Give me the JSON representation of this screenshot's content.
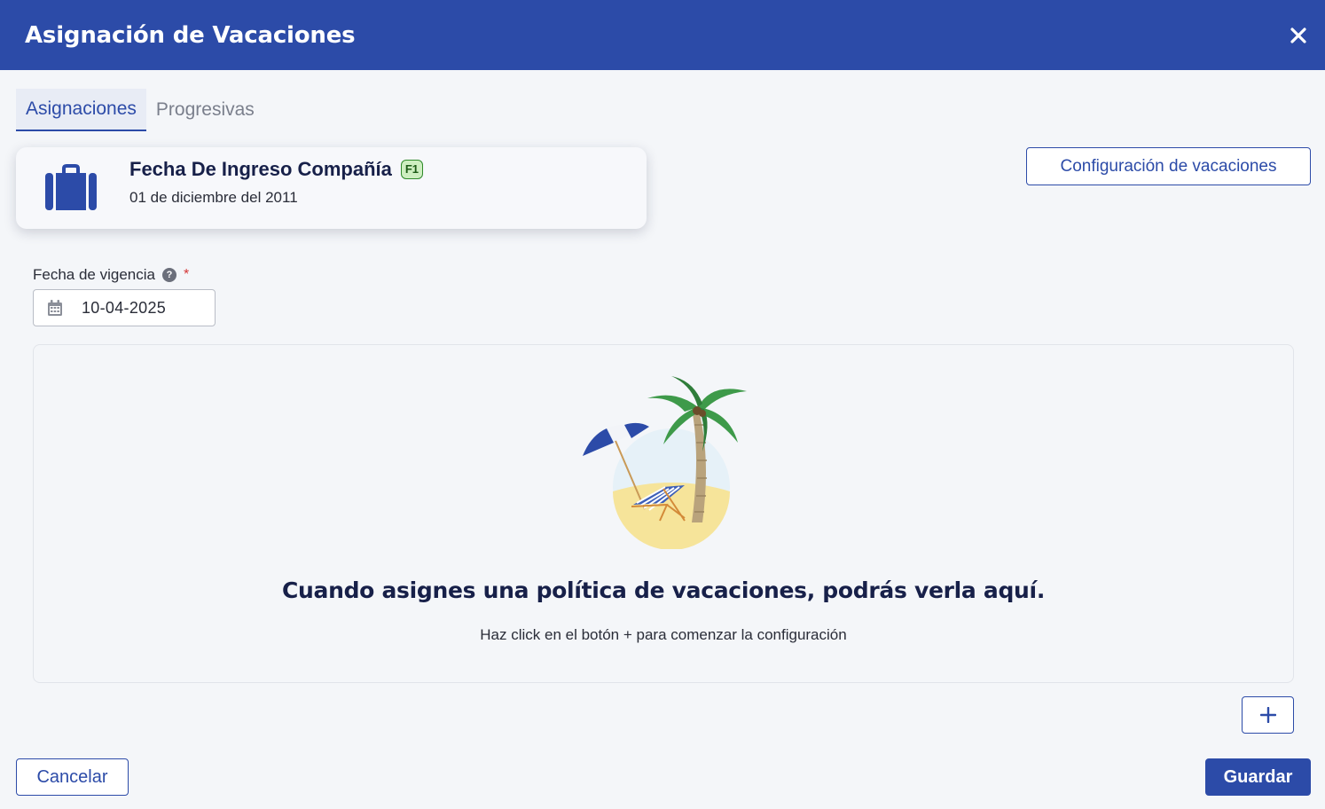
{
  "header": {
    "title": "Asignación de Vacaciones",
    "close_icon": "close-icon"
  },
  "tabs": [
    {
      "label": "Asignaciones",
      "active": true
    },
    {
      "label": "Progresivas",
      "active": false
    }
  ],
  "info_card": {
    "icon": "briefcase-icon",
    "title": "Fecha De Ingreso Compañía",
    "badge": "F1",
    "date": "01 de diciembre del 2011"
  },
  "toolbar": {
    "config_label": "Configuración de vacaciones"
  },
  "form": {
    "effective_date_label": "Fecha de vigencia",
    "help_icon": "help-icon",
    "required_mark": "*",
    "effective_date_value": "10-04-2025",
    "calendar_icon": "calendar-icon"
  },
  "empty_state": {
    "illustration": "beach-palm-illustration",
    "title": "Cuando asignes una política de vacaciones, podrás verla aquí.",
    "subtitle": "Haz click en el botón + para comenzar la configuración"
  },
  "actions": {
    "add_icon": "plus-icon",
    "cancel_label": "Cancelar",
    "save_label": "Guardar"
  },
  "colors": {
    "primary": "#2c4ba8",
    "background": "#f4f6f9",
    "badge_bg": "#cdeec0",
    "badge_border": "#2f8a2b",
    "required": "#d43535"
  }
}
